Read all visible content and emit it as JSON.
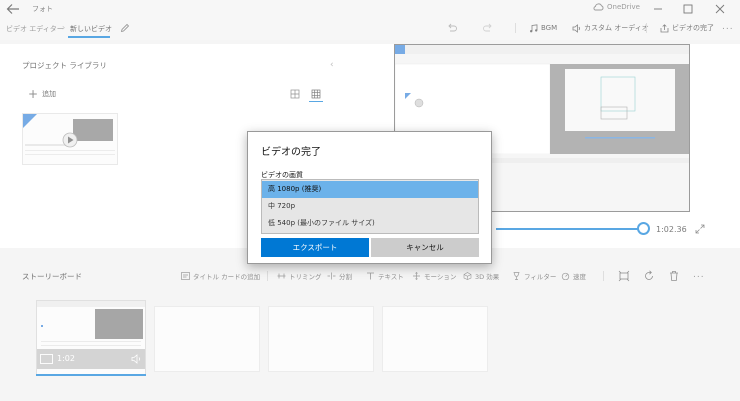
{
  "window": {
    "app_title": "フォト",
    "onedrive_label": "OneDrive"
  },
  "toolbar": {
    "breadcrumb_parent": "ビデオ エディター",
    "breadcrumb_sep": "›",
    "project_title": "新しいビデオ",
    "bgm_label": "BGM",
    "custom_audio_label": "カスタム オーディオ",
    "finish_video_label": "ビデオの完了",
    "more_label": "..."
  },
  "library": {
    "title": "プロジェクト ライブラリ",
    "add_label": "追加",
    "collapse_glyph": "‹"
  },
  "player": {
    "time": "1:02.36",
    "progress": 1.0
  },
  "storyboard": {
    "title": "ストーリーボード",
    "tools": [
      {
        "label": "タイトル カードの追加"
      },
      {
        "label": "トリミング"
      },
      {
        "label": "分割"
      },
      {
        "label": "テキスト"
      },
      {
        "label": "モーション"
      },
      {
        "label": "3D 効果"
      },
      {
        "label": "フィルター"
      },
      {
        "label": "速度"
      }
    ],
    "more_label": "...",
    "clip_duration": "1:02"
  },
  "dialog": {
    "title": "ビデオの完了",
    "quality_label": "ビデオの画質",
    "options": [
      {
        "label": "高 1080p (推奨)",
        "selected": true
      },
      {
        "label": "中 720p",
        "selected": false
      },
      {
        "label": "低 540p (最小のファイル サイズ)",
        "selected": false
      }
    ],
    "export_label": "エクスポート",
    "cancel_label": "キャンセル"
  },
  "colors": {
    "accent": "#0078d4",
    "selected_option": "#6cb2ea"
  }
}
